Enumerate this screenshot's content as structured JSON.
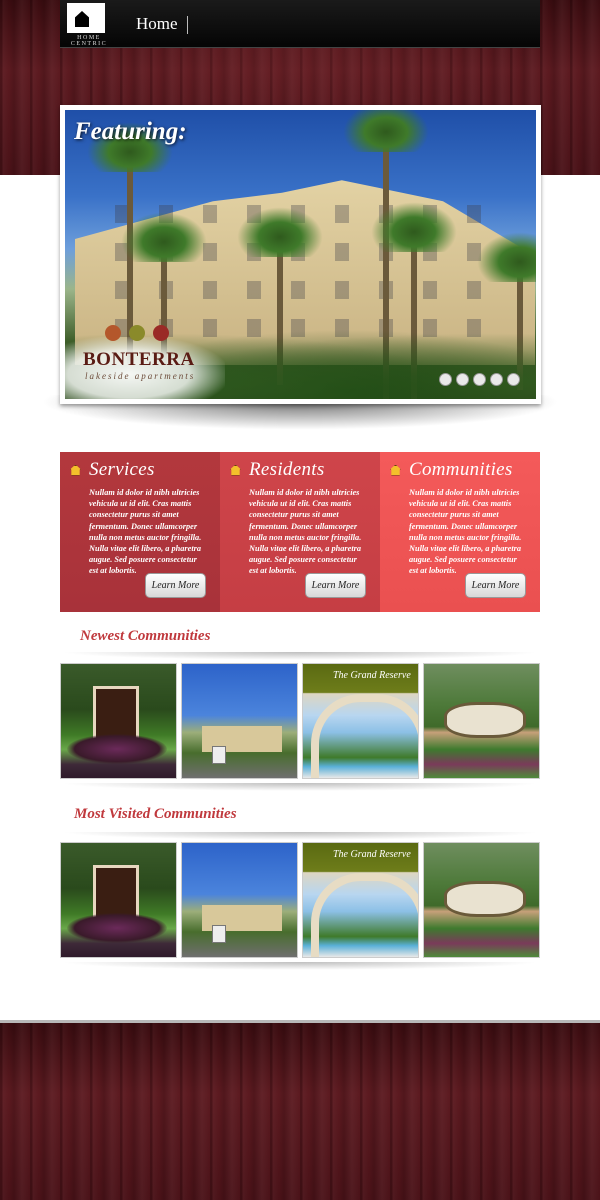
{
  "nav": {
    "logo_text": "HOME CENTRIC",
    "home_label": "Home"
  },
  "featured": {
    "title": "Featuring:",
    "brand_name": "BONTERRA",
    "brand_tagline": "lakeside apartments",
    "slides": 5
  },
  "panels": [
    {
      "title": "Services",
      "text": "Nullam id dolor id nibh ultricies vehicula ut id elit. Cras mattis consectetur purus sit amet fermentum. Donec ullamcorper nulla non metus auctor fringilla. Nulla vitae elit libero, a pharetra augue. Sed posuere consectetur est at lobortis.",
      "button": "Learn More",
      "color": "#b3383d"
    },
    {
      "title": "Residents",
      "text": "Nullam id dolor id nibh ultricies vehicula ut id elit. Cras mattis consectetur purus sit amet fermentum. Donec ullamcorper nulla non metus auctor fringilla. Nulla vitae elit libero, a pharetra augue. Sed posuere consectetur est at lobortis.",
      "button": "Learn More",
      "color": "#cf454a"
    },
    {
      "title": "Communities",
      "text": "Nullam id dolor id nibh ultricies vehicula ut id elit. Cras mattis consectetur purus sit amet fermentum. Donec ullamcorper nulla non metus auctor fringilla. Nulla vitae elit libero, a pharetra augue. Sed posuere consectetur est at lobortis.",
      "button": "Learn More",
      "color": "#f45a5a"
    }
  ],
  "newest": {
    "title": "Newest Communities",
    "grand_caption": "The Grand Reserve"
  },
  "most_visited": {
    "title": "Most Visited Communities",
    "grand_caption": "The Grand Reserve"
  },
  "colors": {
    "accent": "#c0393d",
    "wood": "#4a1218"
  }
}
